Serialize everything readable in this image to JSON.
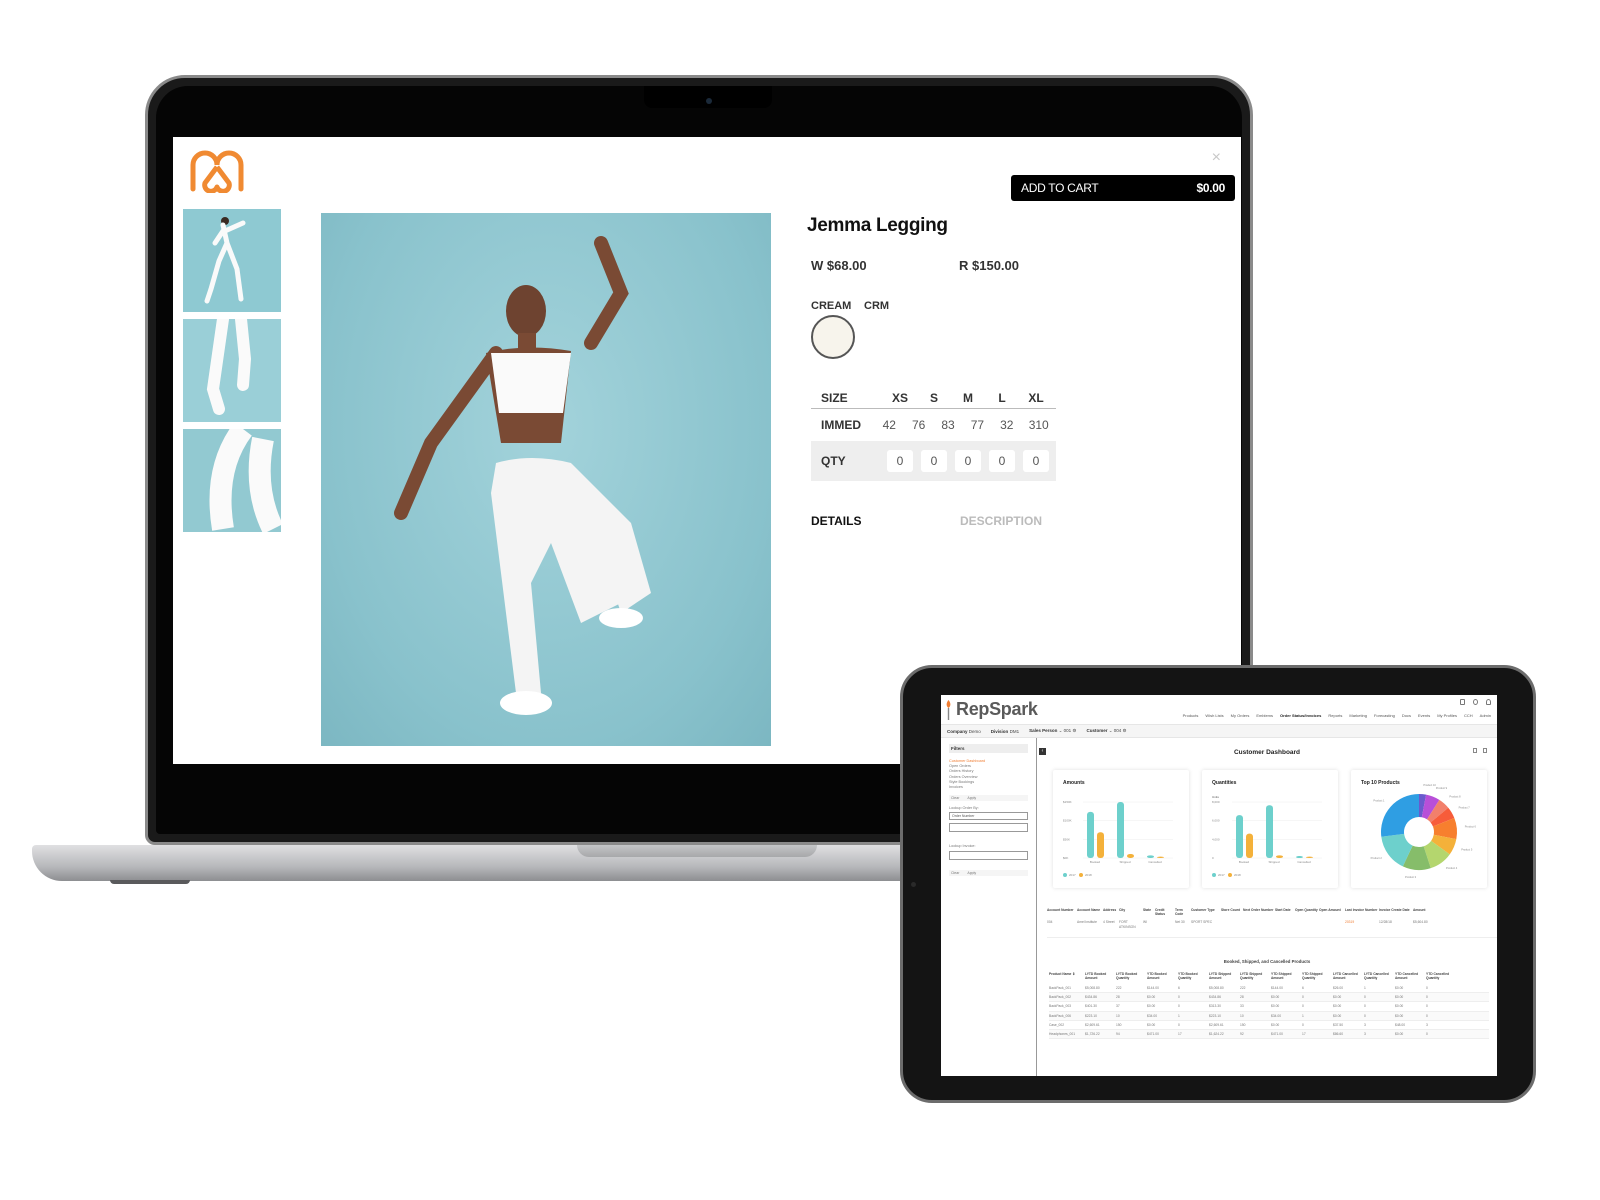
{
  "laptop": {
    "product_page": {
      "close_label": "×",
      "add_to_cart": {
        "label": "ADD TO CART",
        "amount": "$0.00"
      },
      "title": "Jemma Legging",
      "price_wholesale": "W $68.00",
      "price_retail": "R $150.00",
      "color": {
        "name": "CREAM",
        "code": "CRM",
        "swatch_hex": "#f7f4ec"
      },
      "sizes": {
        "header_label": "SIZE",
        "size_names": [
          "XS",
          "S",
          "M",
          "L",
          "XL"
        ],
        "immed_label": "IMMED",
        "immed_values": [
          "42",
          "76",
          "83",
          "77",
          "32"
        ],
        "immed_total": "310",
        "qty_label": "QTY",
        "qty_values": [
          "0",
          "0",
          "0",
          "0",
          "0"
        ]
      },
      "tabs": {
        "details": "DETAILS",
        "description": "DESCRIPTION"
      },
      "thumbnails": [
        "thumbnail-1",
        "thumbnail-2",
        "thumbnail-3"
      ],
      "brand_color": "#f08a32"
    }
  },
  "tablet": {
    "app_name": "RepSpark",
    "accent_color": "#f07d32",
    "nav": [
      "Products",
      "Wish Lists",
      "My Orders",
      "Emblems",
      "Order Status/Invoices",
      "Reports",
      "Marketing",
      "Forecasting",
      "Docs",
      "Events",
      "My Profiles",
      "CCH",
      "Admin"
    ],
    "nav_active": "Order Status/Invoices",
    "context": {
      "company_label": "Company",
      "company_value": "Demo",
      "division_label": "Division",
      "division_value": "DM1",
      "salesperson_label": "Sales Person",
      "salesperson_value": "001",
      "customer_label": "Customer",
      "customer_value": "004"
    },
    "sidebar": {
      "filters_label": "Filters",
      "items": [
        "Customer Dashboard",
        "Open Orders",
        "Orders History",
        "Orders Overview",
        "Style Bookings",
        "Invoices"
      ],
      "active_item": "Customer Dashboard",
      "clear_label": "Clear",
      "apply_label": "Apply",
      "lookup_order_label": "Lookup Order By:",
      "lookup_order_select": "Order Number",
      "lookup_invoice_label": "Lookup Invoice:"
    },
    "dashboard_title": "Customer Dashboard",
    "charts": {
      "amounts": {
        "title": "Amounts",
        "legend": [
          "2017",
          "2018"
        ]
      },
      "quantities": {
        "title": "Quantities",
        "ylabel": "Units",
        "legend": [
          "2017",
          "2018"
        ]
      },
      "top10": {
        "title": "Top 10 Products"
      }
    },
    "account_table": {
      "headers": [
        "Account Number",
        "Account Name",
        "Address",
        "City",
        "State",
        "Credit Status",
        "Term Code",
        "Customer Type",
        "Store Count",
        "Next Order Number",
        "Start Date",
        "Open Quantity",
        "Open Amount",
        "Last Invoice Number",
        "Invoice Create Date",
        "Amount"
      ],
      "row": [
        "004",
        "Amel Institute",
        "4 Street",
        "FORT ATKINSON",
        "WI",
        "",
        "Net 30",
        "SPORT SPEC",
        "",
        "",
        "",
        "",
        "",
        "20319",
        "12/28/18",
        "$5,604.80"
      ]
    },
    "products_table": {
      "title": "Booked, Shipped, and Cancelled Products",
      "headers": [
        "Product Name ⇕",
        "LYTD Booked Amount",
        "LYTD Booked Quantity",
        "YTD Booked Amount",
        "YTD Booked Quantity",
        "LYTD Shipped Amount",
        "LYTD Shipped Quantity",
        "YTD Shipped Amount",
        "YTD Shipped Quantity",
        "LYTD Cancelled Amount",
        "LYTD Cancelled Quantity",
        "YTD Cancelled Amount",
        "YTD Cancelled Quantity"
      ],
      "rows": [
        [
          "BackPack_001",
          "$5,008.80",
          "222",
          "$144.00",
          "6",
          "$5,008.80",
          "222",
          "$144.00",
          "6",
          "$26.00",
          "1",
          "$0.00",
          "0"
        ],
        [
          "BackPack_002",
          "$434.86",
          "28",
          "$0.00",
          "0",
          "$434.86",
          "28",
          "$0.00",
          "0",
          "$0.00",
          "0",
          "$0.00",
          "0"
        ],
        [
          "BackPack_003",
          "$401.30",
          "37",
          "$0.00",
          "0",
          "$313.30",
          "33",
          "$0.00",
          "0",
          "$0.00",
          "0",
          "$0.00",
          "0"
        ],
        [
          "BackPack_006",
          "$223.10",
          "10",
          "$34.00",
          "1",
          "$223.10",
          "10",
          "$34.00",
          "1",
          "$0.00",
          "0",
          "$0.00",
          "0"
        ],
        [
          "Case_002",
          "$2,609.61",
          "150",
          "$0.00",
          "0",
          "$2,609.61",
          "150",
          "$0.00",
          "0",
          "$37.50",
          "3",
          "$48.00",
          "3"
        ],
        [
          "Headphones_001",
          "$1,726.22",
          "94",
          "$471.00",
          "17",
          "$1,624.22",
          "92",
          "$471.00",
          "17",
          "$86.60",
          "3",
          "$0.00",
          "0"
        ]
      ]
    }
  },
  "chart_data": [
    {
      "type": "bar",
      "title": "Amounts",
      "categories": [
        "Booked",
        "Shipped",
        "Cancelled"
      ],
      "series": [
        {
          "name": "2017",
          "color": "#6dd0cc",
          "values": [
            140,
            170,
            8
          ]
        },
        {
          "name": "2018",
          "color": "#f4b13a",
          "values": [
            78,
            12,
            4
          ]
        }
      ],
      "ytick_labels": [
        "$0K",
        "$50K",
        "$100K",
        "$150K"
      ],
      "ylim": [
        0,
        170
      ],
      "grid": true,
      "legend": "bottom-left"
    },
    {
      "type": "bar",
      "title": "Quantities",
      "ylabel": "Units",
      "categories": [
        "Booked",
        "Shipped",
        "Cancelled"
      ],
      "series": [
        {
          "name": "2017",
          "color": "#6dd0cc",
          "values": [
            6500,
            8000,
            300
          ]
        },
        {
          "name": "2018",
          "color": "#f4b13a",
          "values": [
            3700,
            400,
            200
          ]
        }
      ],
      "ytick_labels": [
        "0",
        "4,000",
        "6,000",
        "8,000"
      ],
      "ylim": [
        0,
        8500
      ],
      "grid": true,
      "legend": "bottom-left"
    },
    {
      "type": "pie",
      "title": "Top 10 Products",
      "donut": true,
      "labels": [
        "Product 10",
        "Product 9",
        "Product 8",
        "Product 7",
        "Product 6",
        "Product 5",
        "Product 4",
        "Product 3",
        "Product 2",
        "Product 1"
      ],
      "values": [
        3,
        6,
        5,
        5,
        9,
        7,
        10,
        12,
        16,
        27
      ],
      "colors": [
        "#6a5acd",
        "#b84fd8",
        "#f2806b",
        "#f75c3a",
        "#f77f2e",
        "#f4b13a",
        "#b4d66e",
        "#86bd6a",
        "#6dd0cc",
        "#2f9ee3"
      ]
    }
  ]
}
